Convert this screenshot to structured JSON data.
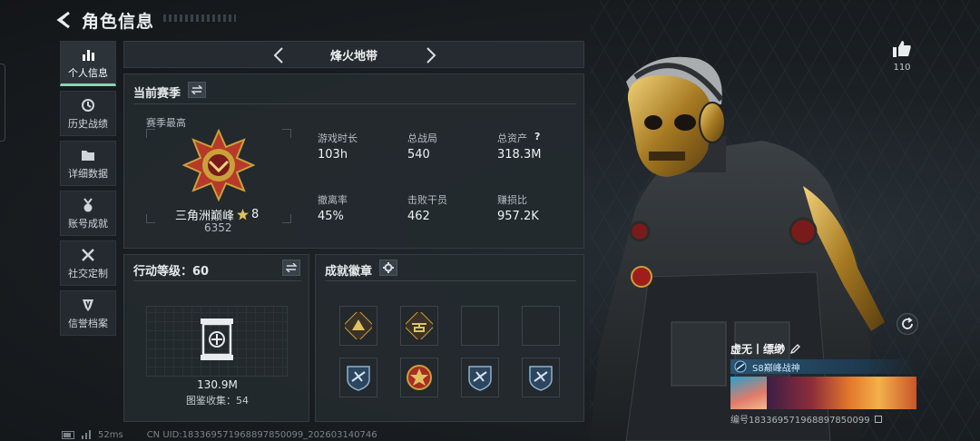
{
  "header": {
    "title": "角色信息"
  },
  "sidebar": {
    "items": [
      {
        "label": "个人信息",
        "icon": "bar-chart-icon",
        "active": true
      },
      {
        "label": "历史战绩",
        "icon": "history-icon",
        "active": false
      },
      {
        "label": "详细数据",
        "icon": "folder-icon",
        "active": false
      },
      {
        "label": "账号成就",
        "icon": "medal-icon",
        "active": false
      },
      {
        "label": "社交定制",
        "icon": "tools-icon",
        "active": false
      },
      {
        "label": "信誉档案",
        "icon": "shield-icon",
        "active": false
      }
    ]
  },
  "map_selector": {
    "name": "烽火地带"
  },
  "season": {
    "title": "当前赛季",
    "best_label": "赛季最高",
    "rank_name": "三角洲巅峰",
    "rank_stars": "8",
    "rank_points": "6352",
    "stats": [
      {
        "label": "游戏时长",
        "value": "103h"
      },
      {
        "label": "总战局",
        "value": "540"
      },
      {
        "label": "总资产",
        "value": "318.3M",
        "help": "?"
      },
      {
        "label": "撤离率",
        "value": "45%"
      },
      {
        "label": "击败干员",
        "value": "462"
      },
      {
        "label": "赚损比",
        "value": "957.2K"
      }
    ]
  },
  "action_level": {
    "title": "行动等级：60",
    "value": "130.9M",
    "collection": "图鉴收集：54"
  },
  "badges": {
    "title": "成就徽章"
  },
  "footer": {
    "ping": "52ms",
    "uid": "CN UID:183369571968897850099_202603140746"
  },
  "likes": {
    "count": "110"
  },
  "profile": {
    "name": "虚无丨缥缈",
    "tag": "S8巅峰战神",
    "id_line": "编号183369571968897850099"
  },
  "colors": {
    "accent": "#8ed1b6",
    "gold": "#c9a13a",
    "panel": "#242a2f"
  }
}
